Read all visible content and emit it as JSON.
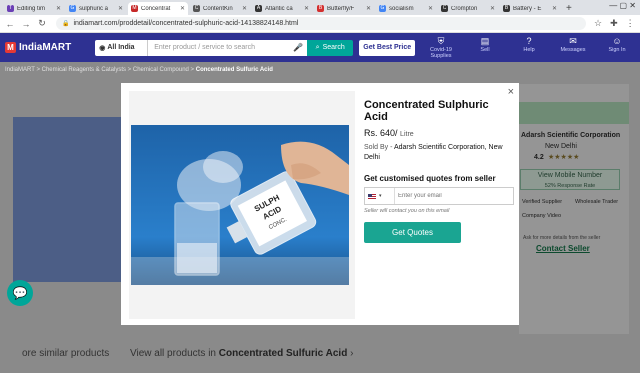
{
  "browser": {
    "tabs": [
      {
        "label": "Editing tim",
        "color": "#6a3fb5",
        "glyph": "T"
      },
      {
        "label": "sulphuric a",
        "color": "#4285f4",
        "glyph": "G"
      },
      {
        "label": "Concentrat",
        "color": "#c62828",
        "glyph": "M",
        "active": true
      },
      {
        "label": "ContentKin",
        "color": "#555555",
        "glyph": "C"
      },
      {
        "label": "Atlantic ca",
        "color": "#333333",
        "glyph": "A"
      },
      {
        "label": "Butterfly/F",
        "color": "#d32f2f",
        "glyph": "B"
      },
      {
        "label": "socialism",
        "color": "#4285f4",
        "glyph": "G"
      },
      {
        "label": "Crompton",
        "color": "#333333",
        "glyph": "C"
      },
      {
        "label": "Battery - E",
        "color": "#333333",
        "glyph": "B"
      }
    ],
    "new_tab": "+",
    "url": "indiamart.com/proddetail/concentrated-sulphuric-acid-14138824148.html"
  },
  "header": {
    "logo": "IndiaMART",
    "location": "All India",
    "search_placeholder": "Enter product / service to search",
    "search_button": "Search",
    "best_price": "Get Best Price",
    "nav": [
      {
        "label": "Covid-19 Supplies",
        "icon": "shield-icon",
        "glyph": "⛨"
      },
      {
        "label": "Sell",
        "icon": "shop-icon",
        "glyph": "▤"
      },
      {
        "label": "Help",
        "icon": "help-icon",
        "glyph": "?"
      },
      {
        "label": "Messages",
        "icon": "messages-icon",
        "glyph": "✉"
      },
      {
        "label": "Sign In",
        "icon": "user-icon",
        "glyph": "☺"
      }
    ]
  },
  "breadcrumb": {
    "items": [
      "IndiaMART",
      "Chemical Reagents & Catalysts",
      "Chemical Compound"
    ],
    "current": "Concentrated Sulfuric Acid"
  },
  "background": {
    "company": "Adarsh Scientific Corporation",
    "location": "New Delhi",
    "rating": "4.2",
    "view_mobile": "View Mobile Number",
    "response_rate": "52% Response Rate",
    "verified": "Verified Supplier",
    "wholesale": "Wholesale Trader",
    "video": "Company Video",
    "ask_details": "Ask for more details from the seller",
    "contact": "Contact Seller",
    "similar_products": "ore similar products",
    "view_all_prefix": "View all products in",
    "view_all_bold": "Concentrated Sulfuric Acid"
  },
  "modal": {
    "title": "Concentrated Sulphuric Acid",
    "price": "Rs. 640/",
    "price_unit": "Litre",
    "sold_by_label": "Sold By - ",
    "sold_by": "Adarsh Scientific Corporation, New Delhi",
    "quotes_heading": "Get customised quotes from seller",
    "email_placeholder": "Enter your email",
    "note": "Seller will contact you on this email",
    "cta": "Get Quotes",
    "close": "×"
  },
  "colors": {
    "brand": "#2e3192",
    "accent": "#1aa592"
  }
}
